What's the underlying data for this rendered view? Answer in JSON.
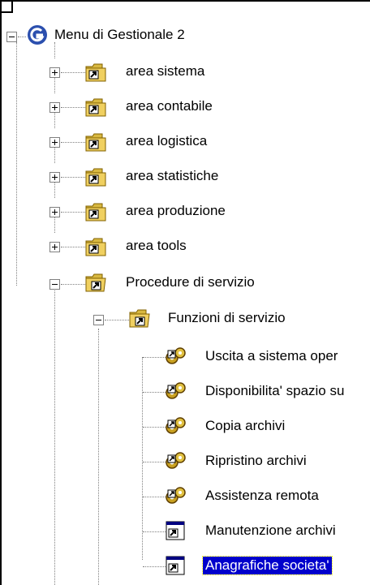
{
  "tree": {
    "root": {
      "label": "Menu di Gestionale 2",
      "icon": "gestionale-logo-icon",
      "expanded": true
    },
    "areas": [
      {
        "label": "area sistema",
        "icon": "shortcut-folder-icon",
        "expanded": false
      },
      {
        "label": "area contabile",
        "icon": "shortcut-folder-icon",
        "expanded": false
      },
      {
        "label": "area logistica",
        "icon": "shortcut-folder-icon",
        "expanded": false
      },
      {
        "label": "area statistiche",
        "icon": "shortcut-folder-icon",
        "expanded": false
      },
      {
        "label": "area produzione",
        "icon": "shortcut-folder-icon",
        "expanded": false
      },
      {
        "label": "area tools",
        "icon": "shortcut-folder-icon",
        "expanded": false
      }
    ],
    "procedure": {
      "label": "Procedure di servizio",
      "icon": "open-shortcut-folder-icon",
      "expanded": true
    },
    "funzioni": {
      "label": "Funzioni di servizio",
      "icon": "open-shortcut-folder-icon",
      "expanded": true
    },
    "items": [
      {
        "label": "Uscita a sistema oper",
        "icon": "gears-icon"
      },
      {
        "label": "Disponibilita' spazio su",
        "icon": "gears-icon"
      },
      {
        "label": "Copia archivi",
        "icon": "gears-icon"
      },
      {
        "label": "Ripristino archivi",
        "icon": "gears-icon"
      },
      {
        "label": "Assistenza remota",
        "icon": "gears-icon"
      },
      {
        "label": "Manutenzione archivi",
        "icon": "window-shortcut-icon"
      },
      {
        "label": "Anagrafiche societa'",
        "icon": "window-shortcut-icon",
        "selected": true
      }
    ],
    "colors": {
      "selection_bg": "#0000cc",
      "selection_text": "#ffffff",
      "folder": "#f0d060"
    }
  }
}
